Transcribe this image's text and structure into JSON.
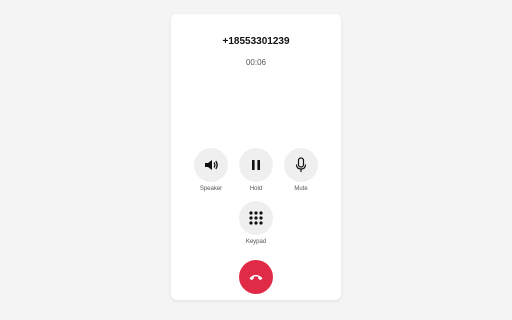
{
  "call": {
    "number": "+18553301239",
    "duration": "00:06"
  },
  "controls": {
    "speaker": {
      "label": "Speaker",
      "icon": "speaker-icon"
    },
    "hold": {
      "label": "Hold",
      "icon": "pause-icon"
    },
    "mute": {
      "label": "Mute",
      "icon": "microphone-icon"
    },
    "keypad": {
      "label": "Keypad",
      "icon": "keypad-icon"
    },
    "end_call": {
      "icon": "hang-up-icon"
    }
  },
  "colors": {
    "end_call": "#df2b45",
    "control_bg": "#efefef",
    "page_bg": "#f4f4f4"
  }
}
